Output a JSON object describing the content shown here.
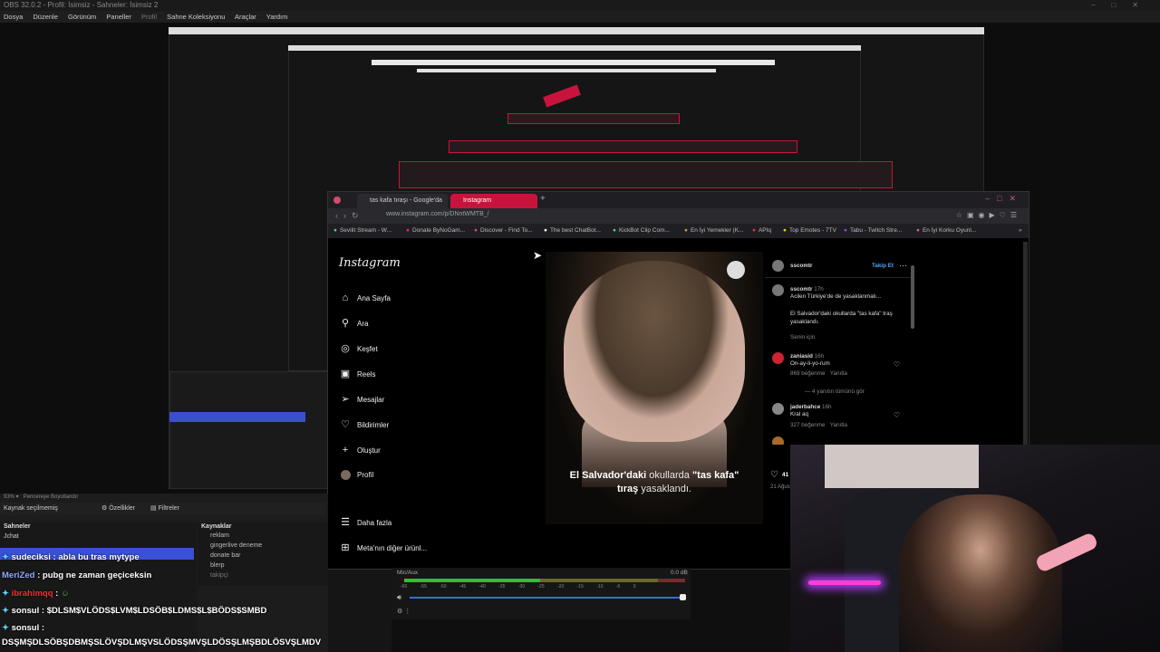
{
  "obs": {
    "window_title": "OBS 32.0.2 - Profil: İsimsiz - Sahneler: İsimsiz 2",
    "menu": [
      "Dosya",
      "Düzenle",
      "Görünüm",
      "Paneller",
      "Profil",
      "Sahne Koleksiyonu",
      "Araçlar",
      "Yardım"
    ],
    "preview_zoom": "93%",
    "preview_mode": "Pencereye Boyutlandır",
    "source_status": "Kaynak seçilmemiş",
    "properties_btn": "Özellikler",
    "filters_btn": "Filtreler",
    "scenes_header": "Sahneler",
    "scenes": [
      "Jchat"
    ],
    "sources_header": "Kaynaklar",
    "sources": [
      "reklam",
      "gingerlive deneme",
      "donate bar",
      "blerp",
      "takipçi"
    ],
    "mixer_label": "Mic/Aux",
    "mixer_db": "0.0 dB",
    "mixer_ticks": [
      "-60",
      "-55",
      "-50",
      "-45",
      "-40",
      "-35",
      "-30",
      "-25",
      "-20",
      "-15",
      "-10",
      "-5",
      "0"
    ]
  },
  "browser": {
    "tabs": [
      "tas kafa tıraşı - Google'da",
      "Instagram"
    ],
    "url": "www.instagram.com/p/DNntWMTB_/",
    "bookmarks": [
      "Sevilit Stream - W...",
      "Donate ByNoGam...",
      "Discover - Find To...",
      "The best ChatBot...",
      "KickBot Clip Com...",
      "En İyi Yemekler (K...",
      "APIq",
      "Top Emotes - 7TV",
      "Tabu - Twitch Stre...",
      "En İyi Korku Oyunl..."
    ]
  },
  "instagram": {
    "logo": "Instagram",
    "nav": [
      "Ana Sayfa",
      "Ara",
      "Keşfet",
      "Reels",
      "Mesajlar",
      "Bildirimler",
      "Oluştur",
      "Profil"
    ],
    "more": "Daha fazla",
    "meta": "Meta'nın diğer ürünl...",
    "post_caption_bold1": "El Salvador'daki",
    "post_caption_thin1": "okullarda",
    "post_caption_bold2": "\"tas kafa\"",
    "post_caption_bold3": "tıraş",
    "post_caption_thin2": "yasaklandı.",
    "author": "sscomtr",
    "follow": "Takip Et",
    "desc_user": "sscomtr",
    "desc_time": "17h",
    "desc_line1": "Acilen Türkiye'de de yasaklanmalı...",
    "desc_line2": "El Salvador'daki okullarda \"tas kafa\" traş yasaklandı.",
    "for_you": "Senin için",
    "comments": [
      {
        "user": "zaniasid",
        "time": "16h",
        "text": "On-ay-li-yo-rum",
        "likes": "869 beğenme",
        "reply": "Yanıtla",
        "more": "4 yanıtın tümünü gör"
      },
      {
        "user": "jaderbahce",
        "time": "16h",
        "text": "Kral aq",
        "likes": "327 beğenme",
        "reply": "Yanıtla"
      }
    ],
    "likes_short": "41",
    "date_short": "21 Ağustos"
  },
  "chat": [
    {
      "user": "sudeciksi",
      "text": "abla bu tras mytype"
    },
    {
      "user": "MeriZed",
      "text": "pubg ne zaman geçiceksin"
    },
    {
      "user": "ibrahimqq",
      "text": ""
    },
    {
      "user": "sonsul",
      "text": "$DLSM$VLÖDS$LVM$LDSÖB$LDMS$L$BÖDS$SMBD"
    },
    {
      "user": "sonsul",
      "text": ""
    },
    {
      "user": "",
      "text": "DSŞMŞDLSÖBŞDBMŞSLÖVŞDLMŞVSLÖDSŞMVŞLDÖSŞLMŞBDLÖSVŞLMDV"
    }
  ],
  "colors": {
    "accent": "#c8143c",
    "obs_bg": "#1c1c1c",
    "ig_bg": "#000000"
  }
}
